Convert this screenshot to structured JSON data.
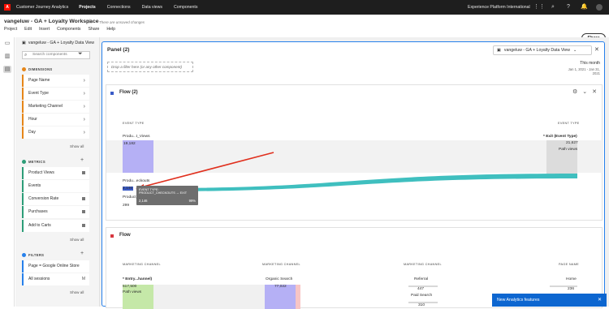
{
  "topbar": {
    "app_name": "Customer Journey Analytics",
    "nav": [
      "Projects",
      "Connections",
      "Data views",
      "Components"
    ],
    "active_nav": "Projects",
    "org": "Experience Platform International",
    "icons": [
      "apps-grid-icon",
      "search-icon",
      "help-icon",
      "notifications-icon",
      "avatar"
    ]
  },
  "project": {
    "title": "vangeluw - GA + Loyalty Workspace",
    "unsaved": "There are unsaved changes",
    "menu": [
      "Project",
      "Edit",
      "Insert",
      "Components",
      "Share",
      "Help"
    ],
    "share_label": "Share"
  },
  "left_panel": {
    "data_view": "vangeluw - GA + Loyalty Data View",
    "search_placeholder": "Search components",
    "dimensions_label": "DIMENSIONS",
    "dimensions": [
      "Page Name",
      "Event Type",
      "Marketing Channel",
      "Hour",
      "Day"
    ],
    "metrics_label": "METRICS",
    "metrics": [
      "Product Views",
      "Events",
      "Conversion Rate",
      "Purchases",
      "Add to Carts"
    ],
    "filters_label": "FILTERS",
    "filters": [
      "Page = Google Online Store",
      "All sessions"
    ],
    "show_all": "Show all"
  },
  "panel": {
    "title": "Panel (2)",
    "data_view": "vangeluw - GA + Loyalty Data View",
    "drop_placeholder": "Drop a filter here (or any other component)",
    "date_label": "This month",
    "date_range": "Jan 1, 2021 - Jan 31, 2021"
  },
  "flow1": {
    "title": "Flow (2)",
    "col_left": "EVENT TYPE",
    "col_right": "EVENT TYPE",
    "node1_label": "Produ...t_Views",
    "node1_value": "19,182",
    "node2_label": "Produ...eckouts",
    "node2_value": "2,146",
    "node3_label": "Product_...",
    "node3_value": "299",
    "exit_label": "* Exit (Event Type)",
    "exit_value": "21,627",
    "exit_sub": "Path views",
    "tooltip_title": "EVENT TYPE: PRODUCT_CHECKOUTS → EXIT",
    "tooltip_value": "2,146",
    "tooltip_pct": "99%",
    "accent_flow": "#3fbfbf",
    "accent_node": "#b5b0f5"
  },
  "flow2": {
    "title": "Flow",
    "cols": [
      "MARKETING CHANNEL",
      "MARKETING CHANNEL",
      "MARKETING CHANNEL",
      "PAGE NAME"
    ],
    "entry_label": "* Entry...hannel)",
    "entry_value": "517,500",
    "entry_sub": "Path views",
    "organic_label": "Organic Search",
    "organic_value": "77,022",
    "referral_label": "Referral",
    "referral_value": "447",
    "paid_label": "Paid Search",
    "paid_value": "310",
    "home_label": "Home",
    "home_value": "236"
  },
  "toast": {
    "label": "New Analytics features"
  }
}
